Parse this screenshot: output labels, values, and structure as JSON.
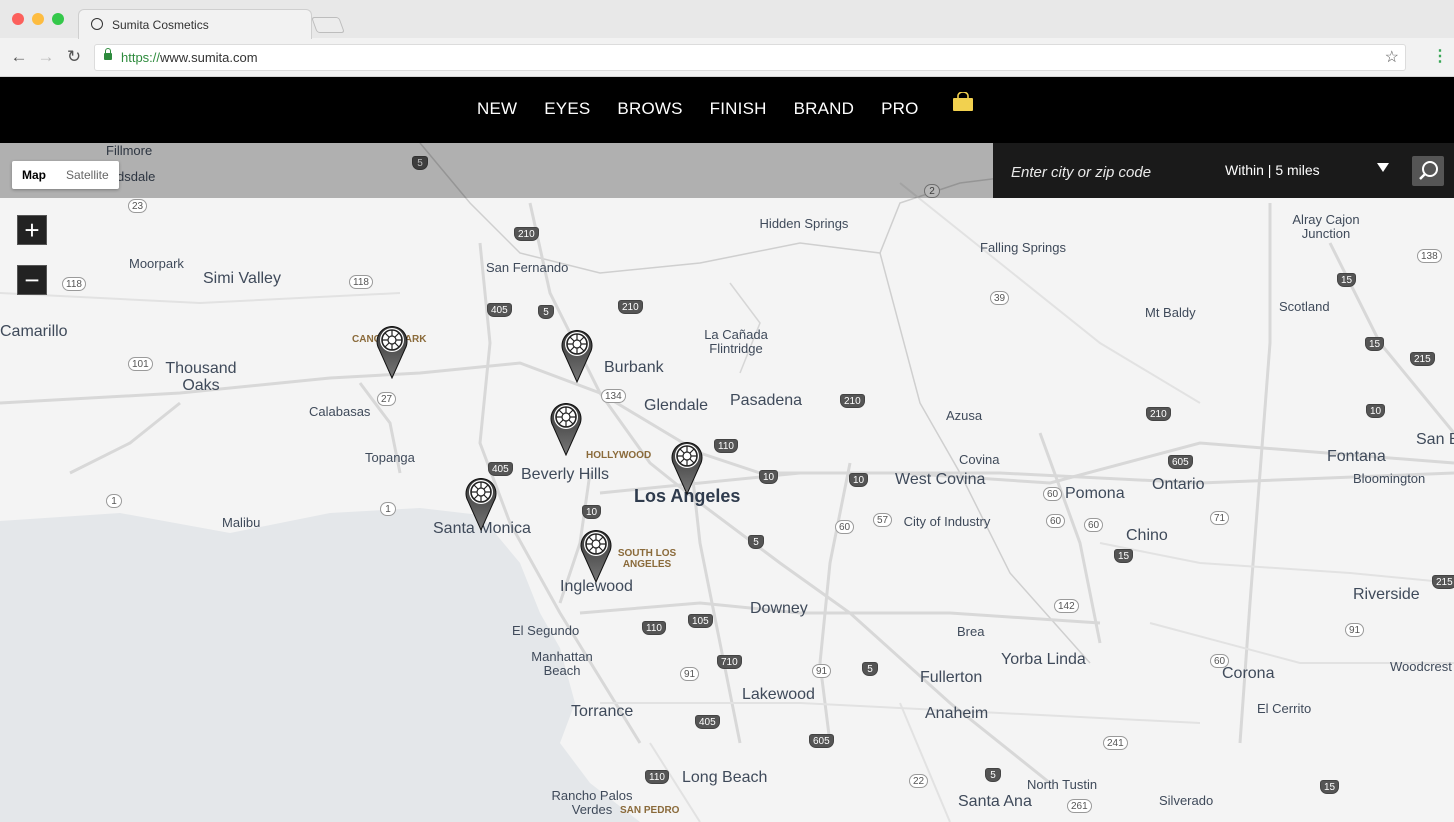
{
  "browser": {
    "tab_title": "Sumita Cosmetics",
    "url_scheme": "https://",
    "url_host": "www.sumita.com"
  },
  "nav": {
    "items": [
      "NEW",
      "EYES",
      "BROWS",
      "FINISH",
      "BRAND",
      "PRO"
    ],
    "cart_icon": "shopping-bag-icon",
    "accent": "#f2d14f"
  },
  "map": {
    "type_controls": {
      "map": "Map",
      "satellite": "Satellite"
    },
    "search": {
      "placeholder": "Enter city or zip code",
      "within_label": "Within |",
      "within_value": "5 miles"
    },
    "zoom": {
      "in": "+",
      "out": "−"
    },
    "major_labels": [
      "Los Angeles"
    ],
    "city_labels": [
      "Simi Valley",
      "Thousand Oaks",
      "Camarillo",
      "Burbank",
      "Glendale",
      "Pasadena",
      "Beverly Hills",
      "Santa Monica",
      "Inglewood",
      "Downey",
      "Torrance",
      "Long Beach",
      "Santa Ana",
      "Anaheim",
      "Fullerton",
      "Yorba Linda",
      "Pomona",
      "Ontario",
      "Chino",
      "Corona",
      "Riverside",
      "Fontana",
      "West Covina",
      "Lakewood",
      "San B"
    ],
    "small_labels": [
      "Fillmore",
      "dsdale",
      "Moorpark",
      "San Fernando",
      "Hidden Springs",
      "Falling Springs",
      "Alray Cajon Junction",
      "Mt Baldy",
      "Scotland",
      "La Cañada Flintridge",
      "Calabasas",
      "Topanga",
      "Malibu",
      "Azusa",
      "Covina",
      "City of Industry",
      "El Segundo",
      "Manhattan Beach",
      "Brea",
      "Rancho Palos Verdes",
      "North Tustin",
      "Silverado",
      "El Cerrito",
      "Woodcrest",
      "Bloomington"
    ],
    "district_labels": [
      "CANOGA PARK",
      "HOLLYWOOD",
      "SOUTH LOS ANGELES",
      "SAN PEDRO"
    ],
    "highway_shields": [
      "5",
      "23",
      "118",
      "118",
      "101",
      "27",
      "405",
      "210",
      "5",
      "210",
      "134",
      "110",
      "210",
      "210",
      "10",
      "10",
      "10",
      "605",
      "60",
      "57",
      "60",
      "60",
      "60",
      "71",
      "15",
      "15",
      "15",
      "138",
      "39",
      "2",
      "1",
      "1",
      "405",
      "10",
      "5",
      "105",
      "110",
      "710",
      "91",
      "5",
      "91",
      "142",
      "241",
      "22",
      "5",
      "261",
      "15",
      "91",
      "405",
      "605",
      "110",
      "60",
      "215",
      "215"
    ],
    "store_pins": 6
  }
}
